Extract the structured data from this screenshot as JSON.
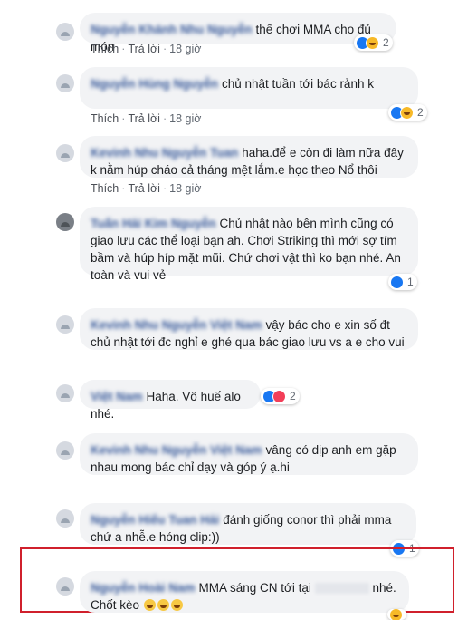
{
  "actions": {
    "like": "Thích",
    "reply": "Trả lời",
    "sep": "·"
  },
  "comments": [
    {
      "author": "Nguyễn Khánh Nhu Nguyễn",
      "text": "thế chơi MMA cho đủ món",
      "time": "18 giờ",
      "reacts": [
        "like",
        "haha"
      ],
      "count": "2"
    },
    {
      "author": "Nguyễn Hùng Nguyễn",
      "text": "chủ nhật tuần tới bác rảnh k",
      "time": "18 giờ",
      "reacts": [
        "like",
        "haha"
      ],
      "count": "2"
    },
    {
      "author": "Kevinh Nhu Nguyễn Tuan",
      "text": "haha.để e còn đi làm nữa đây k nằm húp cháo cả tháng mệt lắm.e học theo Nổ thôi",
      "time": "18 giờ",
      "reacts": [],
      "count": ""
    },
    {
      "author": "Tuấn Hải Kim Nguyễn",
      "text": "Chủ nhật nào bên mình cũng có giao lưu các thể loại bạn ah. Chơi Striking thì mới sợ tím bầm và húp híp mặt mũi. Chứ chơi vật thì ko bạn nhé. An toàn và vui vẻ",
      "time": "",
      "reacts": [
        "like"
      ],
      "count": "1"
    },
    {
      "author": "Kevinh Nhu Nguyễn Việt Nam",
      "text": "vậy bác cho e xin số đt chủ nhật tới đc nghỉ e ghé qua bác giao lưu vs a e cho vui",
      "time": "",
      "reacts": [],
      "count": ""
    },
    {
      "author": "Việt Nam",
      "text": "Haha. Vô huế alo nhé.",
      "time": "",
      "reacts": [
        "like",
        "love"
      ],
      "count": "2"
    },
    {
      "author": "Kevinh Nhu Nguyễn Việt Nam",
      "text": "vâng có dịp anh em gặp nhau mong bác chỉ dạy và góp ý ạ.hi",
      "time": "",
      "reacts": [],
      "count": ""
    },
    {
      "author": "Nguyễn Hiếu Tuan Hải",
      "text": "đánh giống conor thì phải mma chứ a nhễ.e hóng clip:))",
      "time": "",
      "reacts": [
        "like"
      ],
      "count": "1"
    },
    {
      "author": "Nguyễn Hoài Nam",
      "text_a": "MMA sáng CN tới tại",
      "text_b": "nhé. Chốt kèo",
      "time": "",
      "reacts": [
        "haha"
      ],
      "count": ""
    }
  ]
}
